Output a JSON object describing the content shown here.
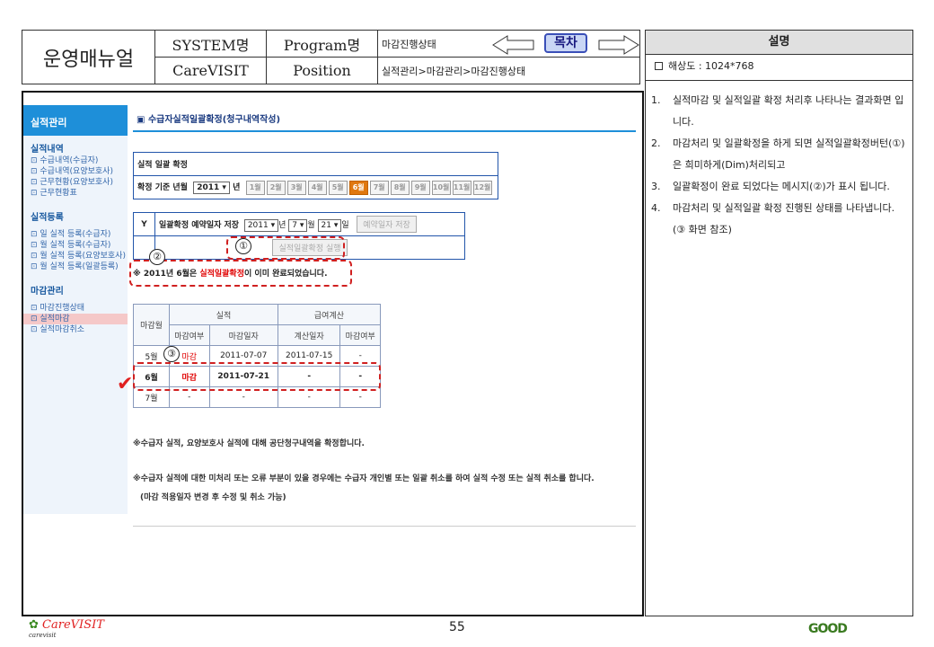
{
  "header": {
    "title": "운영매뉴얼",
    "system_label": "SYSTEM명",
    "system_value": "CareVISIT",
    "program_label": "Program명",
    "position_label": "Position",
    "program_value": "마감진행상태",
    "position_value": "실적관리>마감관리>마감진행상태",
    "toc_label": "목차"
  },
  "desc": {
    "title": "설명",
    "resolution": "해상도 : 1024*768",
    "items": [
      {
        "num": "1.",
        "text": "실적마감 및 실적일괄 확정 처리후 나타나는 결과화면 입니다."
      },
      {
        "num": "2.",
        "text": "마감처리 및 일괄확정을 하게 되면 실적일괄확정버턴(①) 은 희미하게(Dim)처리되고"
      },
      {
        "num": "3.",
        "text": "일괄확정이 완료 되었다는 메시지(②)가 표시 됩니다."
      },
      {
        "num": "4.",
        "text": "마감처리 및 실적일괄 확정 진행된 상태를 나타냅니다.(③ 화면 참조)"
      }
    ]
  },
  "sidebar": {
    "head": "실적관리",
    "sec1": "실적내역",
    "sec1_links": [
      "수급내역(수급자)",
      "수급내역(요양보호사)",
      "근무현황(요양보호사)",
      "근무현황표"
    ],
    "sec2": "실적등록",
    "sec2_links": [
      "일 실적 등록(수급자)",
      "월 실적 등록(수급자)",
      "월 실적 등록(요양보호사)",
      "월 실적 등록(일괄등록)"
    ],
    "sec3": "마감관리",
    "sec3_links": [
      "마감진행상태",
      "실적마감",
      "실적마감취소"
    ]
  },
  "content": {
    "title": "수급자실적일괄확정(청구내역작성)",
    "confirm_head": "실적 일괄 확정",
    "base_label": "확정 기준 년월",
    "year": "2011",
    "year_suffix": "년",
    "months": [
      "1월",
      "2월",
      "3월",
      "4월",
      "5월",
      "6월",
      "7월",
      "8월",
      "9월",
      "10월",
      "11월",
      "12월"
    ],
    "y_mark": "Y",
    "reserve_label": "일괄확정 예약일자 저장",
    "reserve_year": "2011",
    "reserve_month": "7",
    "month_suffix": "월",
    "reserve_day": "21",
    "day_suffix": "일",
    "reserve_btn": "예약일자 저장",
    "exec_btn": "실적일괄확정 실행",
    "msg_pre": "※ 2011년 6월은 ",
    "msg_red": "실적일괄확정",
    "msg_post": "이 이미 완료되었습니다.",
    "table": {
      "h_month": "마감월",
      "h_perf": "실적",
      "h_pay": "급여계산",
      "h_close": "마감여부",
      "h_close_date": "마감일자",
      "h_calc_date": "계산일자",
      "h_close2": "마감여부",
      "rows": [
        {
          "month": "5월",
          "close": "마감",
          "date": "2011-07-07",
          "calc": "2011-07-15",
          "close2": "-"
        },
        {
          "month": "6월",
          "close": "마감",
          "date": "2011-07-21",
          "calc": "-",
          "close2": "-"
        },
        {
          "month": "7월",
          "close": "-",
          "date": "-",
          "calc": "-",
          "close2": "-"
        }
      ]
    },
    "note1": "※수급자 실적, 요양보호사 실적에 대해 공단청구내역을 확정합니다.",
    "note2": "※수급자 실적에 대한 미처리 또는 오류 부분이 있을 경우에는 수급자 개인별 또는 일괄 취소를 하여 실적 수정 또는 실적 취소를 합니다.",
    "note3": "(마감 적용일자 변경 후 수정 및 취소 가능)"
  },
  "markers": {
    "m1": "①",
    "m2": "②",
    "m3": "③"
  },
  "footer": {
    "logo": "CareVISIT",
    "logo_sub": "carevisit",
    "page": "55",
    "good": "GOOD"
  }
}
